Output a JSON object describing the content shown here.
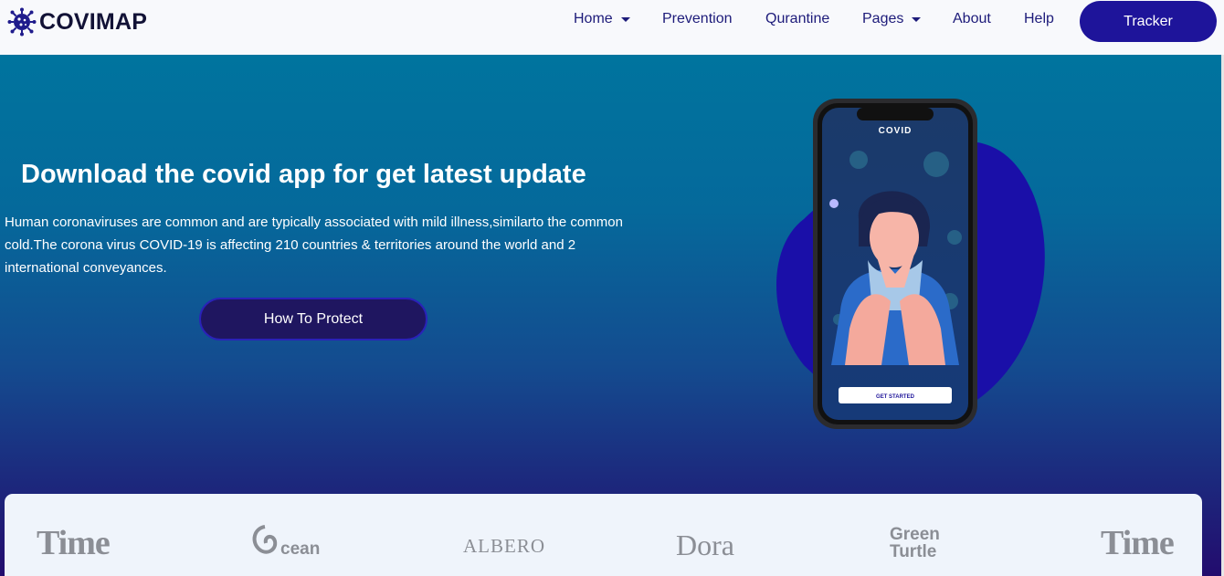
{
  "brand": {
    "name": "COVIMAP",
    "icon": "virus-icon"
  },
  "nav": {
    "items": [
      {
        "label": "Home",
        "dropdown": true
      },
      {
        "label": "Prevention",
        "dropdown": false
      },
      {
        "label": "Qurantine",
        "dropdown": false
      },
      {
        "label": "Pages",
        "dropdown": true
      },
      {
        "label": "About",
        "dropdown": false
      },
      {
        "label": "Help",
        "dropdown": false
      }
    ],
    "tracker_label": "Tracker"
  },
  "hero": {
    "title": "Download the covid app for get latest update",
    "text": "Human coronaviruses are common and are typically associated with mild illness,similarto the common cold.The corona virus COVID-19 is affecting 210 countries & territories around the world and 2 international conveyances.",
    "button_label": "How To Protect",
    "phone": {
      "app_title": "COVID",
      "cta": "GET STARTED"
    }
  },
  "partners": [
    "Time",
    "cean",
    "ALBERO",
    "Dora",
    "Green Turtle",
    "Time"
  ],
  "colors": {
    "primary": "#1e149a",
    "nav_text": "#1d1b7a",
    "hero_top": "#00749e",
    "hero_bottom": "#230c6e",
    "blob": "#1a0fa8"
  }
}
